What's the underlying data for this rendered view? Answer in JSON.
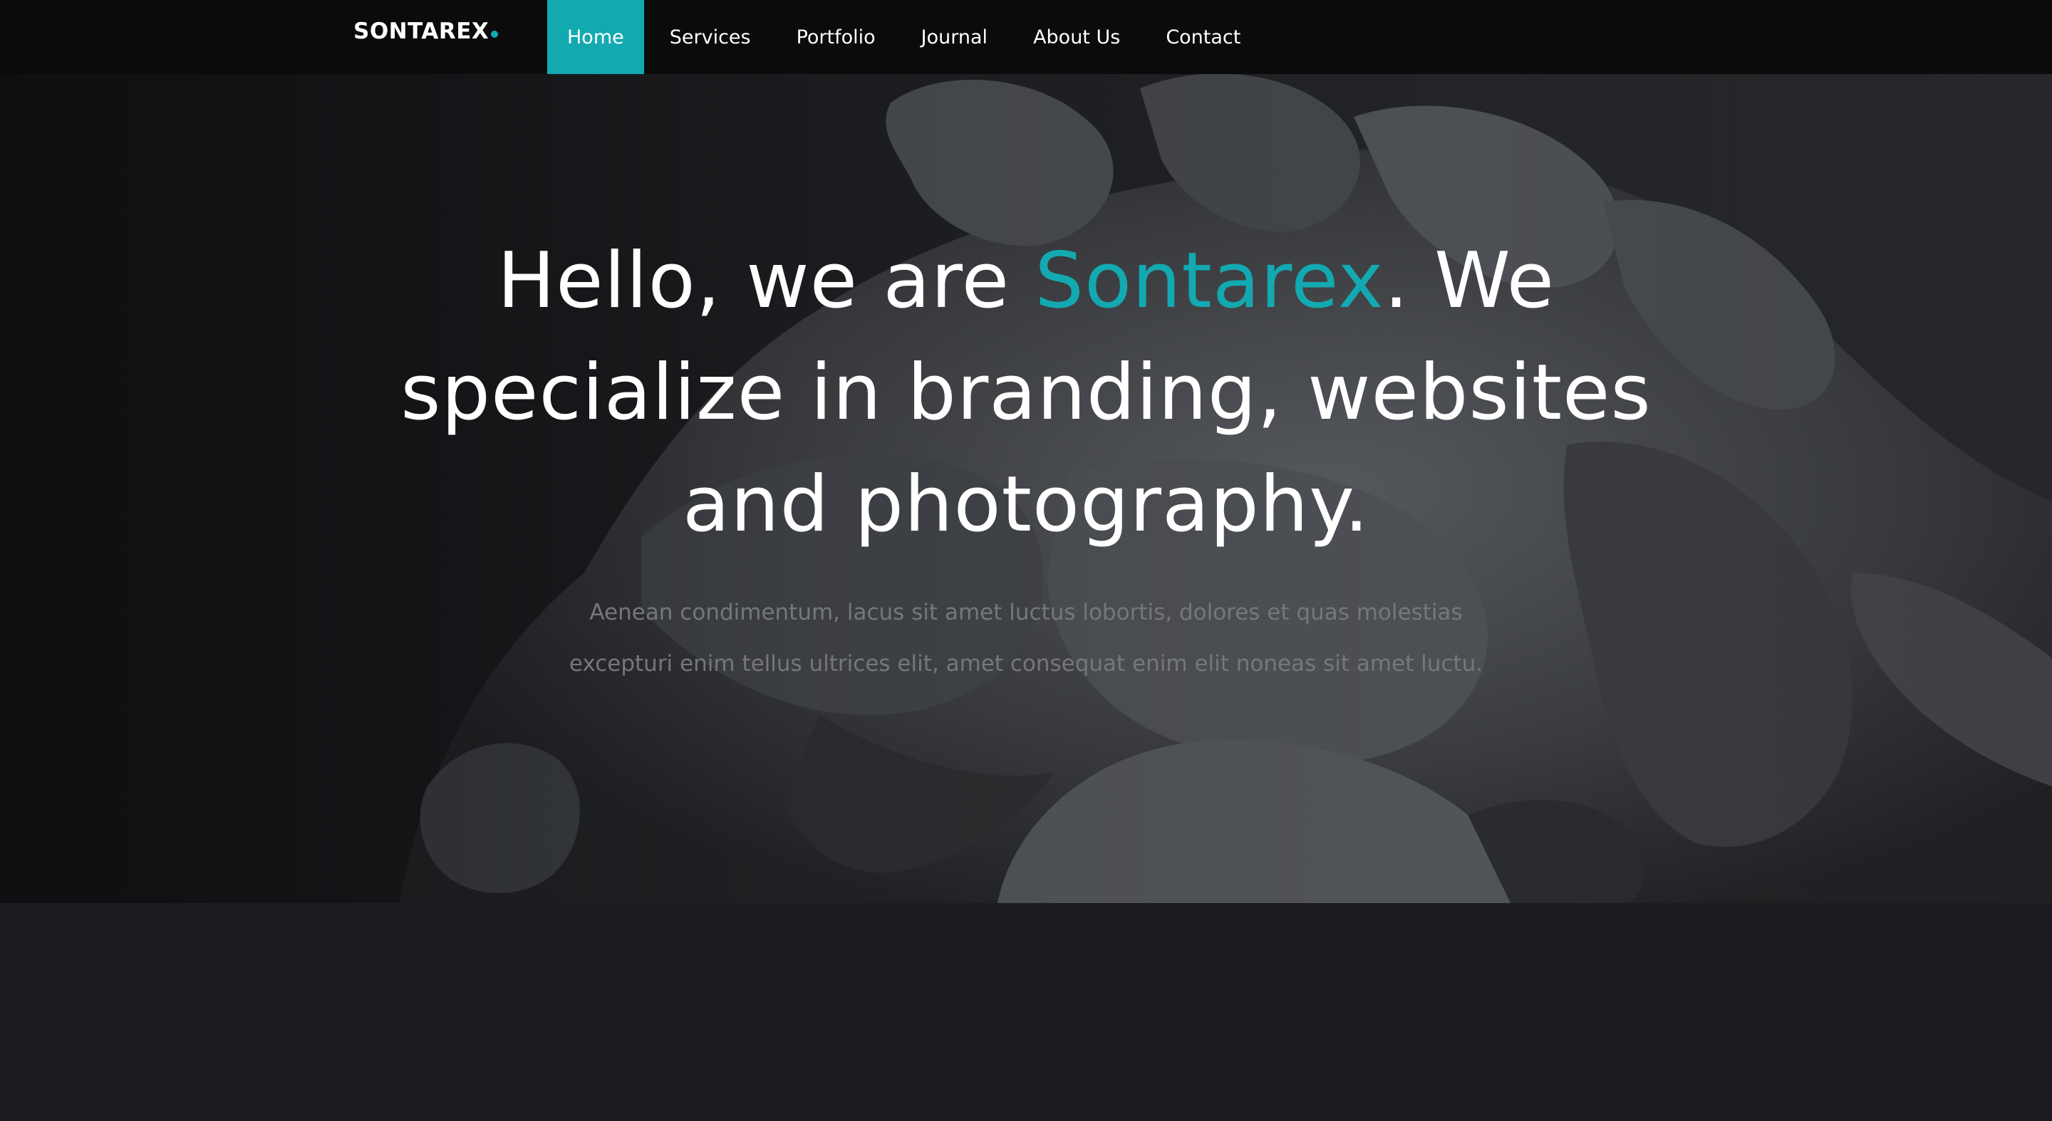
{
  "brand": {
    "name": "SONTAREX",
    "accent_color": "#13a9b0"
  },
  "nav": {
    "items": [
      {
        "label": "Home",
        "active": true
      },
      {
        "label": "Services",
        "active": false
      },
      {
        "label": "Portfolio",
        "active": false
      },
      {
        "label": "Journal",
        "active": false
      },
      {
        "label": "About Us",
        "active": false
      },
      {
        "label": "Contact",
        "active": false
      }
    ]
  },
  "hero": {
    "headline_before": "Hello, we are ",
    "headline_highlight": "Sontarex",
    "headline_after": ". We specialize in branding, websites and photography.",
    "subtext": "Aenean condimentum, lacus sit amet luctus lobortis, dolores et quas molestias excepturi enim tellus ultrices elit, amet consequat enim elit noneas sit amet luctu."
  },
  "colors": {
    "nav_background": "#0b0b0c",
    "page_background": "#1b1c1f",
    "active_nav_background": "#13a9b0"
  }
}
